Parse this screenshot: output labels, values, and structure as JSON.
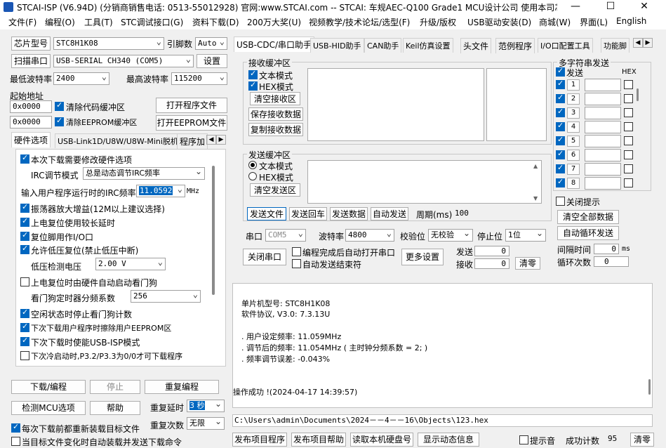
{
  "window": {
    "title": "STCAI-ISP (V6.94D) (分销商销售电话: 0513-55012928) 官网:www.STCAI.com  -- STCAI: 车规AEC-Q100 Grade1 MCU设计公司 使用本司芯片或采..."
  },
  "menu": [
    "文件(F)",
    "编程(O)",
    "工具(T)",
    "STC调试接口(G)",
    "资料下载(D)",
    "200万大奖(U)",
    "视频教学/技术论坛/选型(F)",
    "升级/版权",
    "USB驱动安装(D)",
    "商城(W)",
    "界面(L)",
    "English"
  ],
  "left": {
    "chip_btn": "芯片型号",
    "chip_value": "STC8H1K08",
    "pins_label": "引脚数",
    "pins_value": "Auto",
    "scan_btn": "扫描串口",
    "port_value": "USB-SERIAL CH340 (COM5)",
    "settings_btn": "设置",
    "min_baud_label": "最低波特率",
    "min_baud": "2400",
    "max_baud_label": "最高波特率",
    "max_baud": "115200",
    "start_addr_label": "起始地址",
    "addr1": "0x0000",
    "clear_code": "清除代码缓冲区",
    "open_prog": "打开程序文件",
    "addr2": "0x0000",
    "clear_eeprom": "清除EEPROM缓冲区",
    "open_eeprom": "打开EEPROM文件",
    "tabs": [
      "硬件选项",
      "USB-Link1D/U8W/U8W-Mini脱机",
      "程序加"
    ],
    "opt_modify": "本次下载需要修改硬件选项",
    "irc_mode_label": "IRC调节模式",
    "irc_mode": "总是动态调节IRC频率",
    "irc_freq_label": "输入用户程序运行时的IRC频率",
    "irc_freq": "11.0592",
    "irc_unit": "MHz",
    "opt_osc": "振荡器放大增益(12M以上建议选择)",
    "opt_reset_delay": "上电复位使用较长延时",
    "opt_reset_io": "复位脚用作I/O口",
    "opt_lvr": "允许低压复位(禁止低压中断)",
    "lvd_label": "低压检测电压",
    "lvd_value": "2.00 V",
    "opt_wdt": "上电复位时由硬件自动启动看门狗",
    "wdt_label": "看门狗定时器分频系数",
    "wdt_value": "256",
    "opt_idle_wdt": "空闲状态时停止看门狗计数",
    "opt_erase_eeprom": "下次下载用户程序时擦除用户EEPROM区",
    "opt_usb_isp": "下次下载时使能USB-ISP模式",
    "opt_p32": "下次冷启动时,P3.2/P3.3为0/0才可下载程序",
    "download_btn": "下载/编程",
    "stop_btn": "停止",
    "reprog_btn": "重复编程",
    "detect_btn": "检测MCU选项",
    "help_btn": "帮助",
    "repeat_delay_label": "重复延时",
    "repeat_delay": "3 秒",
    "repeat_count_label": "重复次数",
    "repeat_count": "无限",
    "opt_reload": "每次下载前都重新装载目标文件",
    "opt_auto_send": "当目标文件变化时自动装载并发送下载命令"
  },
  "right_tabs": [
    "USB-CDC/串口助手",
    "USB-HID助手",
    "CAN助手",
    "Keil仿真设置",
    "头文件",
    "范例程序",
    "I/O口配置工具",
    "功能脚"
  ],
  "recv": {
    "title": "接收缓冲区",
    "text_mode": "文本模式",
    "hex_mode": "HEX模式",
    "clear": "清空接收区",
    "save": "保存接收数据",
    "copy": "复制接收数据"
  },
  "send": {
    "title": "发送缓冲区",
    "text_mode": "文本模式",
    "hex_mode": "HEX模式",
    "clear": "清空发送区",
    "send_file": "发送文件",
    "send_back": "发送回车",
    "send_data": "发送数据",
    "auto_send": "自动发送",
    "period_label": "周期(ms)",
    "period": "100"
  },
  "serial": {
    "port_label": "串口",
    "port": "COM5",
    "baud_label": "波特率",
    "baud": "4800",
    "parity_label": "校验位",
    "parity": "无校验",
    "stop_label": "停止位",
    "stop": "1位",
    "close_btn": "关闭串口",
    "opt_auto_open": "编程完成后自动打开串口",
    "opt_auto_end": "自动发送结束符",
    "more_btn": "更多设置",
    "send_label": "发送",
    "send_count": "0",
    "recv_label": "接收",
    "recv_count": "0",
    "clear_btn": "清零"
  },
  "multi": {
    "title": "多字符串发送",
    "send_col": "发送",
    "hex_col": "HEX",
    "rows": [
      "1",
      "2",
      "3",
      "4",
      "5",
      "6",
      "7",
      "8"
    ],
    "close_hint": "关闭提示",
    "clear_all": "清空全部数据",
    "auto_loop": "自动循环发送",
    "interval_label": "间隔时间",
    "interval": "0",
    "interval_unit": "ms",
    "loop_label": "循环次数",
    "loop": "0"
  },
  "log": [
    "单片机型号: STC8H1K08",
    "软件协议, V3.0: 7.3.13U",
    ". 用户设定频率: 11.059MHz",
    ". 调节后的频率: 11.054MHz ( 主时钟分频系数 = 2; )",
    ". 频率调节误差: -0.043%",
    "操作成功 !(2024-04-17 14:39:57)"
  ],
  "path": "C:\\Users\\admin\\Documents\\2024－－4－－16\\Objects\\123.hex",
  "bottom": {
    "publish_prog": "发布项目程序",
    "publish_help": "发布项目帮助",
    "read_disk": "读取本机硬盘号",
    "dynamic_info": "显示动态信息",
    "beep": "提示音",
    "success_label": "成功计数",
    "success_count": "95",
    "clear_btn": "清零"
  }
}
